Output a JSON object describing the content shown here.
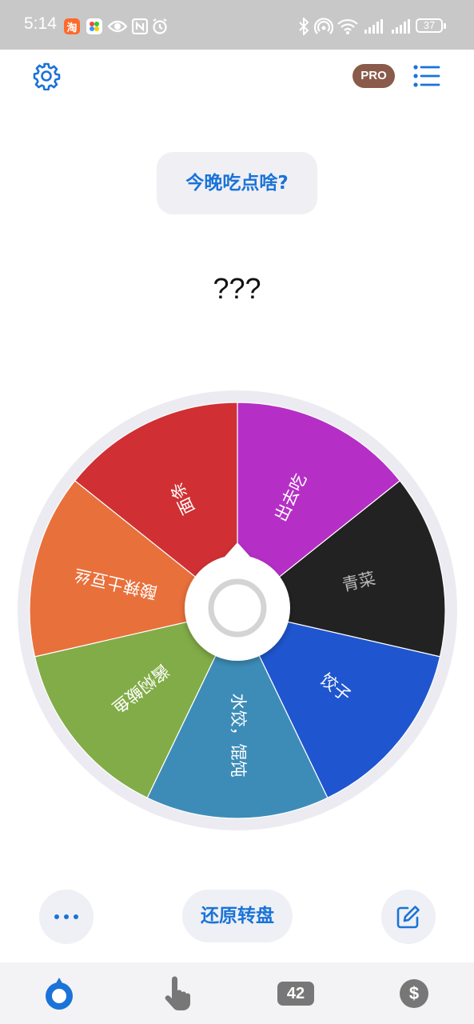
{
  "status_bar": {
    "time": "5:14",
    "battery": "37",
    "icons": [
      "taobao-app-icon",
      "colorful-app-icon",
      "eye-icon",
      "nfc-icon",
      "alarm-icon",
      "bluetooth-icon",
      "hotspot-icon",
      "wifi-icon",
      "signal-icon",
      "signal-icon"
    ]
  },
  "header": {
    "pro_label": "PRO",
    "settings_icon": "gear-icon",
    "list_icon": "list-icon"
  },
  "question": "今晚吃点啥?",
  "result": "???",
  "wheel": {
    "colors": {
      "rim": "#ebebf1",
      "center": "#ffffff"
    },
    "segments": [
      {
        "label": "出去吃",
        "color": "#b52fc6"
      },
      {
        "label": "青菜",
        "color": "#222222"
      },
      {
        "label": "饺子",
        "color": "#1f56cf"
      },
      {
        "label": "水饺，馄饨",
        "color": "#3d8cb8"
      },
      {
        "label": "酱焖鲅鱼",
        "color": "#82ac47"
      },
      {
        "label": "酸辣土豆丝",
        "color": "#e8703b"
      },
      {
        "label": "面条",
        "color": "#d03033"
      }
    ]
  },
  "bottom_actions": {
    "more_icon": "more-dots-icon",
    "reset_label": "还原转盘",
    "edit_icon": "edit-icon"
  },
  "tabbar": {
    "tabs": [
      {
        "icon": "wheel-icon",
        "active": true
      },
      {
        "icon": "hand-pointer-icon",
        "active": false
      },
      {
        "icon": "number-badge-icon",
        "label": "42",
        "active": false
      },
      {
        "icon": "dollar-icon",
        "active": false
      }
    ]
  },
  "accent_color": "#1a73d8"
}
